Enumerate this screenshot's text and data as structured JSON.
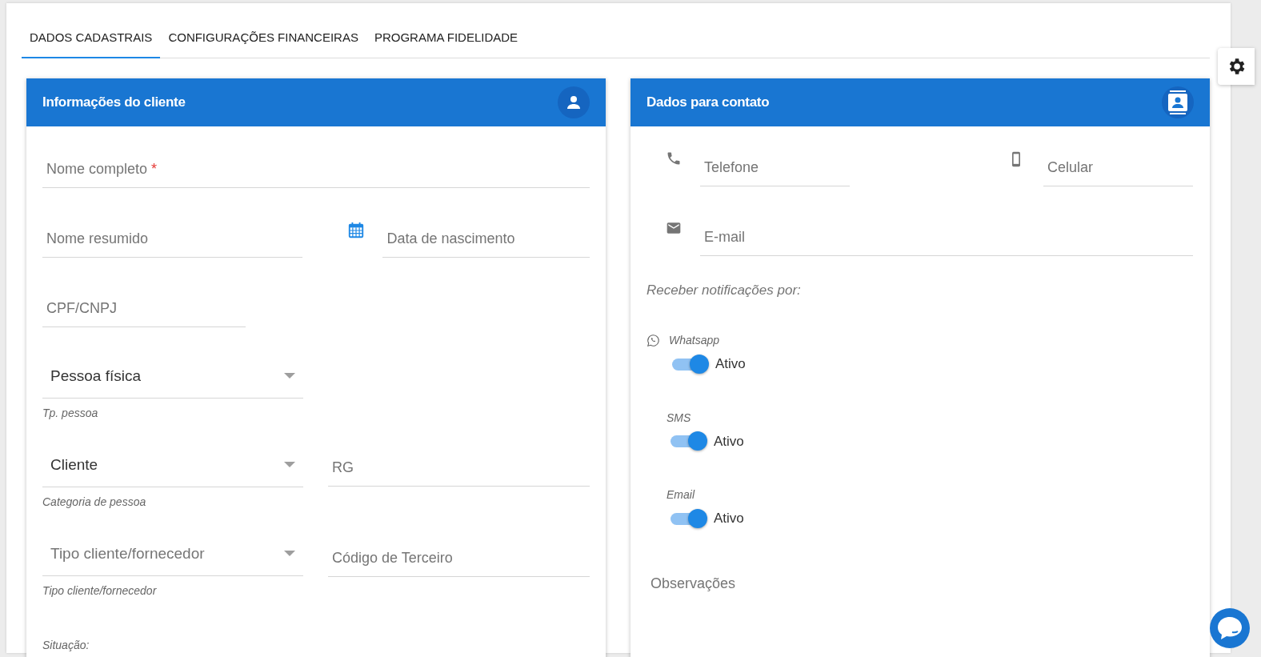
{
  "tabs": [
    {
      "label": "DADOS CADASTRAIS",
      "selected": true
    },
    {
      "label": "CONFIGURAÇÕES FINANCEIRAS",
      "selected": false
    },
    {
      "label": "PROGRAMA FIDELIDADE",
      "selected": false
    }
  ],
  "client_card": {
    "title": "Informações do cliente",
    "full_name": {
      "label": "Nome completo",
      "required_mark": "*"
    },
    "short_name": {
      "label": "Nome resumido"
    },
    "birth_date": {
      "label": "Data de nascimento"
    },
    "document": {
      "label": "CPF/CNPJ"
    },
    "person_type": {
      "value": "Pessoa física",
      "helper": "Tp. pessoa"
    },
    "person_category": {
      "value": "Cliente",
      "helper": "Categoria de pessoa"
    },
    "rg": {
      "label": "RG"
    },
    "client_supplier_type": {
      "placeholder": "Tipo cliente/fornecedor",
      "helper": "Tipo cliente/fornecedor"
    },
    "third_party_code": {
      "label": "Código de Terceiro"
    },
    "status_label": "Situação:"
  },
  "contact_card": {
    "title": "Dados para contato",
    "phone": {
      "label": "Telefone"
    },
    "mobile": {
      "label": "Celular"
    },
    "email": {
      "label": "E-mail"
    },
    "notify_heading": "Receber notificações por:",
    "channels": [
      {
        "kind": "icon",
        "name": "Whatsapp",
        "on": true,
        "state": "Ativo"
      },
      {
        "kind": "plain",
        "name": "SMS",
        "on": true,
        "state": "Ativo"
      },
      {
        "kind": "plain",
        "name": "Email",
        "on": true,
        "state": "Ativo"
      }
    ],
    "notes": {
      "label": "Observações"
    }
  }
}
